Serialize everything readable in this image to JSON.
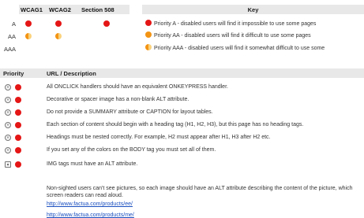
{
  "matrix": {
    "headers": [
      "WCAG1",
      "WCAG2",
      "Section 508"
    ],
    "rows": [
      "A",
      "AA",
      "AAA"
    ]
  },
  "key": {
    "title": "Key",
    "items": [
      {
        "icon": "red-dot-icon",
        "label": "Priority A - disabled users will find it impossible to use some pages"
      },
      {
        "icon": "orange-dot-icon",
        "label": "Priority AA - disabled users will find it difficult to use some pages"
      },
      {
        "icon": "half-orange-dot-icon",
        "label": "Priority AAA - disabled users will find it somewhat difficult to use some"
      }
    ]
  },
  "table": {
    "col_priority": "Priority",
    "col_url": "URL / Description",
    "issues": [
      "All ONCLICK handlers should have an equivalent ONKEYPRESS handler.",
      "Decorative or spacer image has a non-blank ALT attribute.",
      "Do not provide a SUMMARY attribute or CAPTION for layout tables.",
      "Each section of content should begin with a heading tag (H1, H2, H3), but this page has no heading tags.",
      "Headings must be nested correctly. For example, H2 must appear after H1, H3 after H2 etc.",
      "If you set any of the colors on the BODY tag you must set all of them.",
      "IMG tags must have an ALT attribute."
    ],
    "description": "Non-sighted users can't see pictures, so each image should have an ALT attribute describing the content of the picture, which screen readers can read aloud.",
    "links": [
      "http://www.factua.com/products/ee/",
      "http://www.factua.com/products/me/"
    ]
  },
  "colors": {
    "priority_a": "#e51616",
    "priority_aa": "#f39414",
    "header_bg": "#e8e8e8",
    "link": "#1a4fbf"
  }
}
